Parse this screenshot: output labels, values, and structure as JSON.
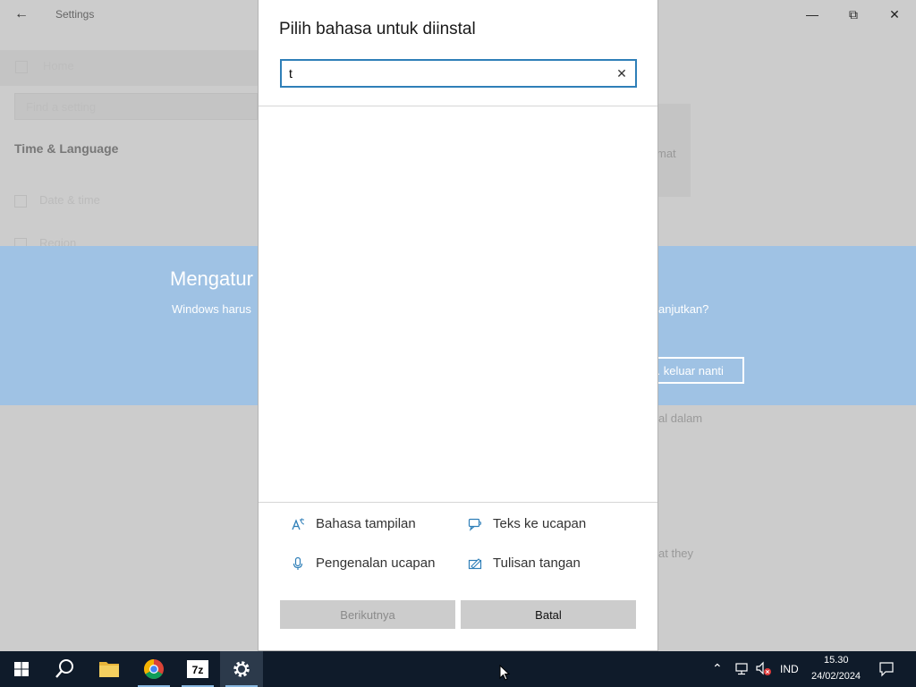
{
  "settings": {
    "window_title": "Settings",
    "home_label": "Home",
    "search_placeholder": "Find a setting",
    "section_title": "Time & Language",
    "nav": [
      "Date & time",
      "Region"
    ],
    "card_text": "mat",
    "partial_text_1": "al dalam",
    "partial_text_2": "at they"
  },
  "banner": {
    "heading": "Mengatur",
    "body_left": "Windows harus",
    "body_right": "anjutkan?",
    "later_button": "k. keluar nanti"
  },
  "dialog": {
    "title": "Pilih bahasa untuk diinstal",
    "search_value": "t",
    "features": [
      {
        "label": "Bahasa tampilan",
        "icon": "display-language-icon"
      },
      {
        "label": "Teks ke ucapan",
        "icon": "text-to-speech-icon"
      },
      {
        "label": "Pengenalan ucapan",
        "icon": "microphone-icon"
      },
      {
        "label": "Tulisan tangan",
        "icon": "handwriting-icon"
      }
    ],
    "next_button": "Berikutnya",
    "cancel_button": "Batal"
  },
  "taskbar": {
    "apps": [
      "start",
      "search",
      "file-explorer",
      "chrome",
      "7-zip",
      "settings"
    ],
    "language": "IND",
    "time": "15.30",
    "date": "24/02/2024"
  },
  "colors": {
    "accent": "#2f7fb8",
    "banner": "#9fc2e4",
    "taskbar": "#0f1b2a"
  }
}
